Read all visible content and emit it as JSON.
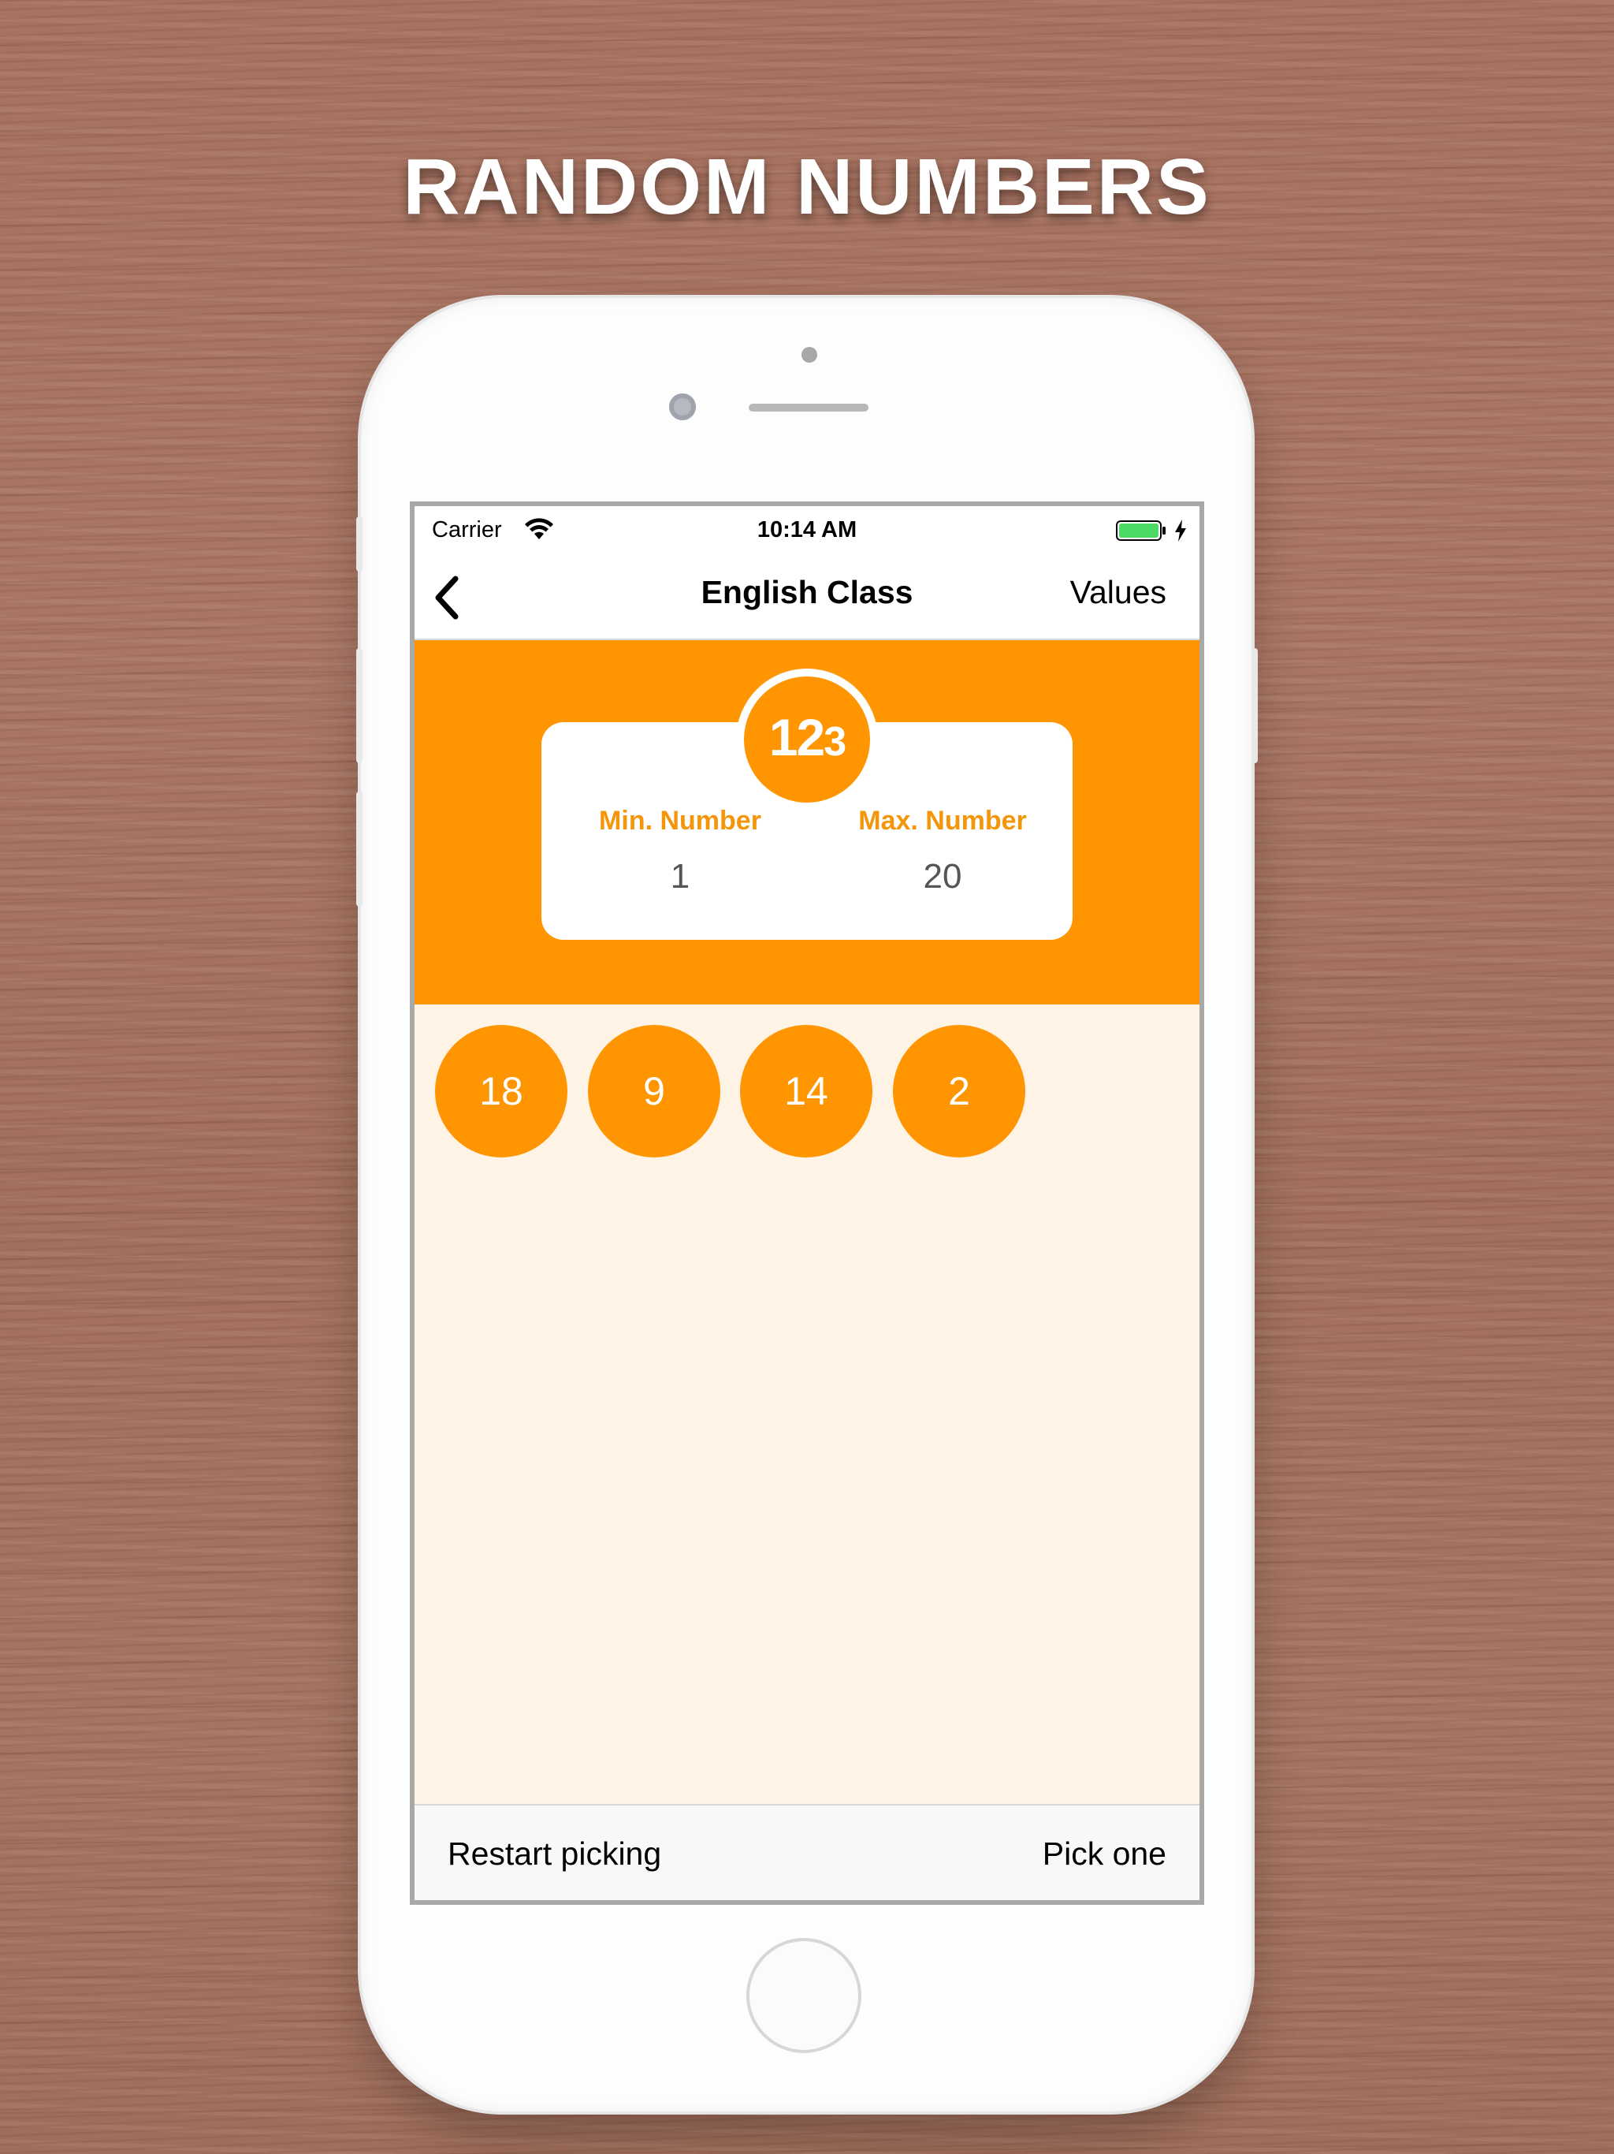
{
  "headline": "RANDOM NUMBERS",
  "status_bar": {
    "carrier": "Carrier",
    "time": "10:14 AM",
    "battery_color": "#4cd964"
  },
  "navbar": {
    "back_icon": "chevron-left-icon",
    "title": "English Class",
    "right_button": "Values"
  },
  "range": {
    "badge_digits": [
      "1",
      "2",
      "3"
    ],
    "min_label": "Min. Number",
    "min_value": "1",
    "max_label": "Max. Number",
    "max_value": "20"
  },
  "picked_numbers": [
    "18",
    "9",
    "14",
    "2"
  ],
  "toolbar": {
    "restart_label": "Restart picking",
    "pick_label": "Pick one"
  },
  "colors": {
    "accent": "#ff9500",
    "picked_background": "#fff3e5"
  }
}
